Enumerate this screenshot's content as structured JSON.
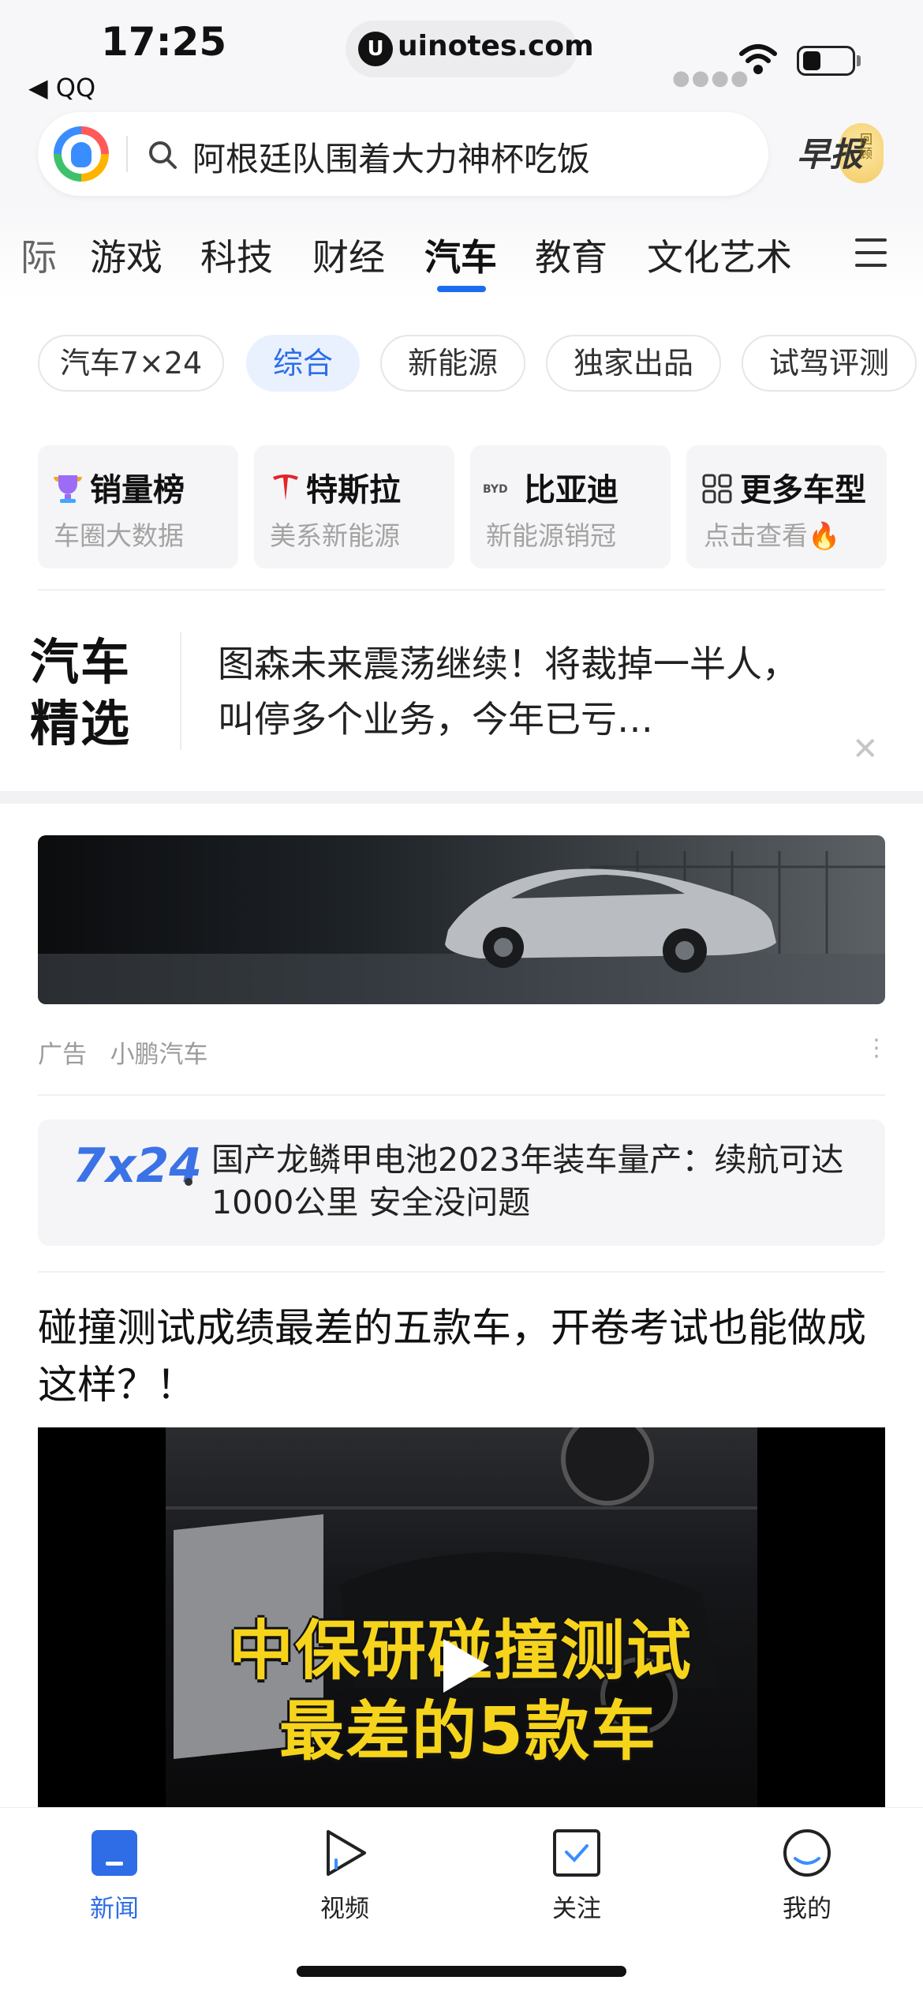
{
  "status_bar": {
    "time": "17:25",
    "back_app": "◀ QQ",
    "url": "uinotes.com",
    "url_icon_letter": "U"
  },
  "search": {
    "query": "阿根廷队围着大力神杯吃饭",
    "morning_label": "早报",
    "morning_sub": "回顾"
  },
  "tabs": [
    {
      "label": "际",
      "active": false
    },
    {
      "label": "游戏",
      "active": false
    },
    {
      "label": "科技",
      "active": false
    },
    {
      "label": "财经",
      "active": false
    },
    {
      "label": "汽车",
      "active": true
    },
    {
      "label": "教育",
      "active": false
    },
    {
      "label": "文化艺术",
      "active": false
    }
  ],
  "chips": [
    {
      "label": "汽车7×24",
      "active": false
    },
    {
      "label": "综合",
      "active": true
    },
    {
      "label": "新能源",
      "active": false
    },
    {
      "label": "独家出品",
      "active": false
    },
    {
      "label": "试驾评测",
      "active": false
    }
  ],
  "cards": [
    {
      "icon": "trophy-icon",
      "title": "销量榜",
      "sub": "车圈大数据"
    },
    {
      "icon": "tesla-logo-icon",
      "title": "特斯拉",
      "sub": "美系新能源"
    },
    {
      "icon": "byd-logo-icon",
      "title": "比亚迪",
      "sub": "新能源销冠"
    },
    {
      "icon": "grid-icon",
      "title": "更多车型",
      "sub": "点击查看🔥"
    }
  ],
  "featured": {
    "logo_line1": "汽车",
    "logo_line2": "精选",
    "text": "图森未来震荡继续！将裁掉一半人，叫停多个业务，今年已亏…"
  },
  "ad": {
    "label": "广告",
    "advertiser": "小鹏汽车",
    "more": "···"
  },
  "news724": {
    "logo": "7x24",
    "text": "国产龙鳞甲电池2023年装车量产：续航可达1000公里 安全没问题"
  },
  "article": {
    "title": "碰撞测试成绩最差的五款车，开卷考试也能做成这样？！",
    "caption_line1": "中保研碰撞测试",
    "caption_line2": "最差的5款车"
  },
  "bottom_nav": [
    {
      "label": "新闻",
      "icon": "news-icon",
      "active": true
    },
    {
      "label": "视频",
      "icon": "video-icon",
      "active": false
    },
    {
      "label": "关注",
      "icon": "follow-icon",
      "active": false
    },
    {
      "label": "我的",
      "icon": "profile-icon",
      "active": false
    }
  ],
  "colors": {
    "accent": "#1c6cf0",
    "chip_active_bg": "#eaf1fe",
    "caption_yellow": "#f6d41c"
  }
}
